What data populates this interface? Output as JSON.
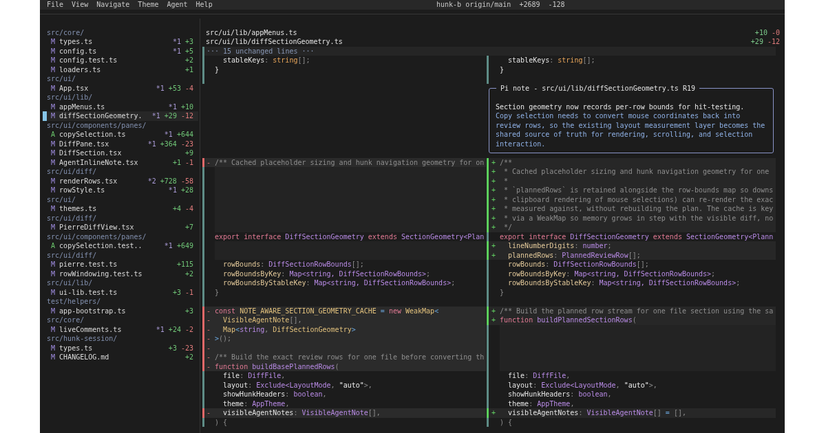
{
  "menu": {
    "items": [
      "File",
      "View",
      "Navigate",
      "Theme",
      "Agent",
      "Help"
    ],
    "status": "hunk-b origin/main  +2689  -128"
  },
  "sidebar": {
    "groups": [
      {
        "folder": "src/core/",
        "files": [
          {
            "status": "M",
            "kind": "modified",
            "name": "types.ts",
            "comments": "*1",
            "added": "+3",
            "selected": false
          },
          {
            "status": "M",
            "kind": "modified",
            "name": "config.ts",
            "comments": "*1",
            "added": "+5",
            "selected": false
          },
          {
            "status": "M",
            "kind": "modified",
            "name": "config.test.ts",
            "added": "+2",
            "selected": false
          },
          {
            "status": "M",
            "kind": "modified",
            "name": "loaders.ts",
            "added": "+1",
            "selected": false
          }
        ]
      },
      {
        "folder": "src/ui/",
        "files": [
          {
            "status": "M",
            "kind": "modified",
            "name": "App.tsx",
            "comments": "*1",
            "added": "+53",
            "removed": "-4",
            "selected": false
          }
        ]
      },
      {
        "folder": "src/ui/lib/",
        "files": [
          {
            "status": "M",
            "kind": "modified",
            "name": "appMenus.ts",
            "comments": "*1",
            "added": "+10",
            "selected": false
          },
          {
            "status": "M",
            "kind": "modified",
            "name": "diffSectionGeometry.",
            "comments": "*1",
            "added": "+29",
            "removed": "-12",
            "selected": true
          }
        ]
      },
      {
        "folder": "src/ui/components/panes/",
        "files": [
          {
            "status": "A",
            "kind": "added",
            "name": "copySelection.ts",
            "comments": "*1",
            "added": "+644",
            "selected": false
          },
          {
            "status": "M",
            "kind": "modified",
            "name": "DiffPane.tsx",
            "comments": "*1",
            "added": "+364",
            "removed": "-23",
            "selected": false
          },
          {
            "status": "M",
            "kind": "modified",
            "name": "DiffSection.tsx",
            "added": "+9",
            "selected": false
          },
          {
            "status": "M",
            "kind": "modified",
            "name": "AgentInlineNote.tsx",
            "added": "+1",
            "removed": "-1",
            "selected": false
          }
        ]
      },
      {
        "folder": "src/ui/diff/",
        "files": [
          {
            "status": "M",
            "kind": "modified",
            "name": "renderRows.tsx",
            "comments": "*2",
            "added": "+728",
            "removed": "-58",
            "selected": false
          },
          {
            "status": "M",
            "kind": "modified",
            "name": "rowStyle.ts",
            "comments": "*1",
            "added": "+28",
            "selected": false
          }
        ]
      },
      {
        "folder": "src/ui/",
        "files": [
          {
            "status": "M",
            "kind": "modified",
            "name": "themes.ts",
            "added": "+4",
            "removed": "-4",
            "selected": false
          }
        ]
      },
      {
        "folder": "src/ui/diff/",
        "files": [
          {
            "status": "M",
            "kind": "modified",
            "name": "PierreDiffView.tsx",
            "added": "+7",
            "selected": false
          }
        ]
      },
      {
        "folder": "src/ui/components/panes/",
        "files": [
          {
            "status": "A",
            "kind": "added",
            "name": "copySelection.test..",
            "comments": "*1",
            "added": "+649",
            "selected": false
          }
        ]
      },
      {
        "folder": "src/ui/diff/",
        "files": [
          {
            "status": "M",
            "kind": "modified",
            "name": "pierre.test.ts",
            "added": "+115",
            "selected": false
          },
          {
            "status": "M",
            "kind": "modified",
            "name": "rowWindowing.test.ts",
            "added": "+2",
            "selected": false
          }
        ]
      },
      {
        "folder": "src/ui/lib/",
        "files": [
          {
            "status": "M",
            "kind": "modified",
            "name": "ui-lib.test.ts",
            "added": "+3",
            "removed": "-1",
            "selected": false
          }
        ]
      },
      {
        "folder": "test/helpers/",
        "files": [
          {
            "status": "M",
            "kind": "modified",
            "name": "app-bootstrap.ts",
            "added": "+3",
            "selected": false
          }
        ]
      },
      {
        "folder": "src/core/",
        "files": [
          {
            "status": "M",
            "kind": "modified",
            "name": "liveComments.ts",
            "comments": "*1",
            "added": "+24",
            "removed": "-2",
            "selected": false
          }
        ]
      },
      {
        "folder": "src/hunk-session/",
        "files": [
          {
            "status": "M",
            "kind": "modified",
            "name": "types.ts",
            "added": "+3",
            "removed": "-23",
            "selected": false
          },
          {
            "status": "M",
            "kind": "modified",
            "name": "CHANGELOG.md",
            "added": "+2",
            "selected": false
          }
        ]
      }
    ]
  },
  "diff": {
    "files": [
      {
        "path": "src/ui/lib/appMenus.ts",
        "added": "+10",
        "removed": "-0"
      },
      {
        "path": "src/ui/lib/diffSectionGeometry.ts",
        "added": "+29",
        "removed": "-12"
      }
    ],
    "rows": [
      {
        "kind": "separator",
        "text": "··· 15 unchanged lines ···"
      },
      {
        "kind": "split",
        "left": {
          "kind": "context",
          "tokens": [
            {
              "kind": "name",
              "text": "  stableKeys"
            },
            {
              "kind": "punctuation",
              "text": ": "
            },
            {
              "kind": "builtin",
              "text": "string"
            },
            {
              "kind": "punctuation",
              "text": "[];"
            }
          ]
        },
        "right": {
          "kind": "context",
          "tokens": [
            {
              "kind": "name",
              "text": "  stableKeys"
            },
            {
              "kind": "punctuation",
              "text": ": "
            },
            {
              "kind": "builtin",
              "text": "string"
            },
            {
              "kind": "punctuation",
              "text": "[];"
            }
          ]
        }
      },
      {
        "kind": "split",
        "left": {
          "kind": "context",
          "tokens": [
            {
              "kind": "name",
              "text": "}"
            }
          ]
        },
        "right": {
          "kind": "context",
          "tokens": [
            {
              "kind": "name",
              "text": "}"
            }
          ]
        }
      },
      {
        "kind": "split",
        "left": {
          "kind": "context"
        },
        "right": {
          "kind": "context"
        }
      },
      {
        "kind": "note",
        "title": "Pi note - src/ui/lib/diffSectionGeometry.ts R19",
        "summary": "Section geometry now records per-row bounds for hit-testing.",
        "body": "Copy selection needs to convert mouse coordinates back into review rows, so the existing layout measurement layer becomes the shared source of truth for rendering, scrolling, and selection interaction."
      },
      {
        "kind": "split",
        "left": {
          "kind": "delete",
          "marker": "-",
          "tokens": [
            {
              "kind": "comment",
              "text": "/** Cached placeholder sizing and hunk navigation geometry for on"
            }
          ]
        },
        "right": {
          "kind": "add",
          "marker": "+",
          "tokens": [
            {
              "kind": "comment",
              "text": "/**"
            }
          ]
        }
      },
      {
        "kind": "split",
        "left": {
          "kind": "filler"
        },
        "right": {
          "kind": "add",
          "marker": "+",
          "tokens": [
            {
              "kind": "comment",
              "text": " * Cached placeholder sizing and hunk navigation geometry for one"
            }
          ]
        }
      },
      {
        "kind": "split",
        "left": {
          "kind": "filler"
        },
        "right": {
          "kind": "add",
          "marker": "+",
          "tokens": [
            {
              "kind": "comment",
              "text": " *"
            }
          ]
        }
      },
      {
        "kind": "split",
        "left": {
          "kind": "filler"
        },
        "right": {
          "kind": "add",
          "marker": "+",
          "tokens": [
            {
              "kind": "comment",
              "text": " * `plannedRows` is retained alongside the row-bounds map so downs"
            }
          ]
        }
      },
      {
        "kind": "split",
        "left": {
          "kind": "filler"
        },
        "right": {
          "kind": "add",
          "marker": "+",
          "tokens": [
            {
              "kind": "comment",
              "text": " * clipboard rendering of mouse selections) can re-render the exac"
            }
          ]
        }
      },
      {
        "kind": "split",
        "left": {
          "kind": "filler"
        },
        "right": {
          "kind": "add",
          "marker": "+",
          "tokens": [
            {
              "kind": "comment",
              "text": " * measured against, without rebuilding the plan. The cache is key"
            }
          ]
        }
      },
      {
        "kind": "split",
        "left": {
          "kind": "filler"
        },
        "right": {
          "kind": "add",
          "marker": "+",
          "tokens": [
            {
              "kind": "comment",
              "text": " * via a WeakMap so memory grows in step with the visible diff, no"
            }
          ]
        }
      },
      {
        "kind": "split",
        "left": {
          "kind": "filler"
        },
        "right": {
          "kind": "add",
          "marker": "+",
          "tokens": [
            {
              "kind": "comment",
              "text": " */"
            }
          ]
        }
      },
      {
        "kind": "split",
        "left": {
          "kind": "context",
          "tokens": [
            {
              "kind": "keyword",
              "text": "export interface "
            },
            {
              "kind": "type",
              "text": "DiffSectionGeometry "
            },
            {
              "kind": "keyword",
              "text": "extends "
            },
            {
              "kind": "type",
              "text": "SectionGeometry<Plan"
            }
          ]
        },
        "right": {
          "kind": "context",
          "tokens": [
            {
              "kind": "keyword",
              "text": "export interface "
            },
            {
              "kind": "type",
              "text": "DiffSectionGeometry "
            },
            {
              "kind": "keyword",
              "text": "extends "
            },
            {
              "kind": "type",
              "text": "SectionGeometry<Plann"
            }
          ]
        }
      },
      {
        "kind": "split",
        "left": {
          "kind": "filler"
        },
        "right": {
          "kind": "add",
          "marker": "+",
          "tokens": [
            {
              "kind": "property",
              "text": "  lineNumberDigits"
            },
            {
              "kind": "punctuation",
              "text": ": "
            },
            {
              "kind": "type",
              "text": "number"
            },
            {
              "kind": "punctuation",
              "text": ";"
            }
          ]
        }
      },
      {
        "kind": "split",
        "left": {
          "kind": "filler"
        },
        "right": {
          "kind": "add",
          "marker": "+",
          "tokens": [
            {
              "kind": "property",
              "text": "  plannedRows"
            },
            {
              "kind": "punctuation",
              "text": ": "
            },
            {
              "kind": "type",
              "text": "PlannedReviewRow"
            },
            {
              "kind": "punctuation",
              "text": "[];"
            }
          ]
        }
      },
      {
        "kind": "split",
        "left": {
          "kind": "context",
          "tokens": [
            {
              "kind": "property",
              "text": "  rowBounds"
            },
            {
              "kind": "punctuation",
              "text": ": "
            },
            {
              "kind": "type",
              "text": "DiffSectionRowBounds"
            },
            {
              "kind": "punctuation",
              "text": "[];"
            }
          ]
        },
        "right": {
          "kind": "context",
          "tokens": [
            {
              "kind": "property",
              "text": "  rowBounds"
            },
            {
              "kind": "punctuation",
              "text": ": "
            },
            {
              "kind": "type",
              "text": "DiffSectionRowBounds"
            },
            {
              "kind": "punctuation",
              "text": "[];"
            }
          ]
        }
      },
      {
        "kind": "split",
        "left": {
          "kind": "context",
          "tokens": [
            {
              "kind": "property",
              "text": "  rowBoundsByKey"
            },
            {
              "kind": "punctuation",
              "text": ": "
            },
            {
              "kind": "type",
              "text": "Map<string, DiffSectionRowBounds>"
            },
            {
              "kind": "punctuation",
              "text": ";"
            }
          ]
        },
        "right": {
          "kind": "context",
          "tokens": [
            {
              "kind": "property",
              "text": "  rowBoundsByKey"
            },
            {
              "kind": "punctuation",
              "text": ": "
            },
            {
              "kind": "type",
              "text": "Map<string, DiffSectionRowBounds>"
            },
            {
              "kind": "punctuation",
              "text": ";"
            }
          ]
        }
      },
      {
        "kind": "split",
        "left": {
          "kind": "context",
          "tokens": [
            {
              "kind": "property",
              "text": "  rowBoundsByStableKey"
            },
            {
              "kind": "punctuation",
              "text": ": "
            },
            {
              "kind": "type",
              "text": "Map<string, DiffSectionRowBounds>"
            },
            {
              "kind": "punctuation",
              "text": ";"
            }
          ]
        },
        "right": {
          "kind": "context",
          "tokens": [
            {
              "kind": "property",
              "text": "  rowBoundsByStableKey"
            },
            {
              "kind": "punctuation",
              "text": ": "
            },
            {
              "kind": "type",
              "text": "Map<string, DiffSectionRowBounds>"
            },
            {
              "kind": "punctuation",
              "text": ";"
            }
          ]
        }
      },
      {
        "kind": "split",
        "left": {
          "kind": "context",
          "tokens": [
            {
              "kind": "punctuation",
              "text": "}"
            }
          ]
        },
        "right": {
          "kind": "context",
          "tokens": [
            {
              "kind": "punctuation",
              "text": "}"
            }
          ]
        }
      },
      {
        "kind": "split",
        "left": {
          "kind": "context"
        },
        "right": {
          "kind": "context"
        }
      },
      {
        "kind": "split",
        "left": {
          "kind": "delete",
          "marker": "-",
          "tokens": [
            {
              "kind": "keyword",
              "text": "const "
            },
            {
              "kind": "constant",
              "text": "NOTE_AWARE_SECTION_GEOMETRY_CACHE "
            },
            {
              "kind": "operator",
              "text": "= "
            },
            {
              "kind": "keyword",
              "text": "new "
            },
            {
              "kind": "constant",
              "text": "WeakMap"
            },
            {
              "kind": "operator",
              "text": "<"
            }
          ]
        },
        "right": {
          "kind": "add",
          "marker": "+",
          "tokens": [
            {
              "kind": "comment",
              "text": "/** Build the planned row stream for one file section using the sa"
            }
          ]
        }
      },
      {
        "kind": "split",
        "left": {
          "kind": "delete",
          "marker": "-",
          "tokens": [
            {
              "kind": "constant",
              "text": "  VisibleAgentNote"
            },
            {
              "kind": "punctuation",
              "text": "[],"
            }
          ]
        },
        "right": {
          "kind": "add",
          "marker": "+",
          "tokens": [
            {
              "kind": "keyword",
              "text": "function "
            },
            {
              "kind": "type",
              "text": "buildPlannedSectionRows"
            },
            {
              "kind": "punctuation",
              "text": "("
            }
          ]
        }
      },
      {
        "kind": "split",
        "left": {
          "kind": "delete",
          "marker": "-",
          "tokens": [
            {
              "kind": "constant",
              "text": "  Map"
            },
            {
              "kind": "operator",
              "text": "<"
            },
            {
              "kind": "type",
              "text": "string"
            },
            {
              "kind": "punctuation",
              "text": ", "
            },
            {
              "kind": "constant",
              "text": "DiffSectionGeometry"
            },
            {
              "kind": "operator",
              "text": ">"
            }
          ]
        },
        "right": {
          "kind": "filler"
        }
      },
      {
        "kind": "split",
        "left": {
          "kind": "delete",
          "marker": "-",
          "tokens": [
            {
              "kind": "operator",
              "text": ">"
            },
            {
              "kind": "punctuation",
              "text": "();"
            }
          ]
        },
        "right": {
          "kind": "filler"
        }
      },
      {
        "kind": "split",
        "left": {
          "kind": "delete",
          "marker": "-"
        },
        "right": {
          "kind": "filler"
        }
      },
      {
        "kind": "split",
        "left": {
          "kind": "delete",
          "marker": "-",
          "tokens": [
            {
              "kind": "comment",
              "text": "/** Build the exact review rows for one file before converting th"
            }
          ]
        },
        "right": {
          "kind": "filler"
        }
      },
      {
        "kind": "split",
        "left": {
          "kind": "delete",
          "marker": "-",
          "tokens": [
            {
              "kind": "keyword",
              "text": "function "
            },
            {
              "kind": "type",
              "text": "buildBasePlannedRows"
            },
            {
              "kind": "punctuation",
              "text": "("
            }
          ]
        },
        "right": {
          "kind": "filler"
        }
      },
      {
        "kind": "split",
        "left": {
          "kind": "context",
          "tokens": [
            {
              "kind": "name",
              "text": "  file"
            },
            {
              "kind": "punctuation",
              "text": ": "
            },
            {
              "kind": "type",
              "text": "DiffFile"
            },
            {
              "kind": "punctuation",
              "text": ","
            }
          ]
        },
        "right": {
          "kind": "context",
          "tokens": [
            {
              "kind": "name",
              "text": "  file"
            },
            {
              "kind": "punctuation",
              "text": ": "
            },
            {
              "kind": "type",
              "text": "DiffFile"
            },
            {
              "kind": "punctuation",
              "text": ","
            }
          ]
        }
      },
      {
        "kind": "split",
        "left": {
          "kind": "context",
          "tokens": [
            {
              "kind": "name",
              "text": "  layout"
            },
            {
              "kind": "punctuation",
              "text": ": "
            },
            {
              "kind": "type",
              "text": "Exclude<LayoutMode"
            },
            {
              "kind": "punctuation",
              "text": ", "
            },
            {
              "kind": "string",
              "text": "\"auto\""
            },
            {
              "kind": "punctuation",
              "text": ">,"
            }
          ]
        },
        "right": {
          "kind": "context",
          "tokens": [
            {
              "kind": "name",
              "text": "  layout"
            },
            {
              "kind": "punctuation",
              "text": ": "
            },
            {
              "kind": "type",
              "text": "Exclude<LayoutMode"
            },
            {
              "kind": "punctuation",
              "text": ", "
            },
            {
              "kind": "string",
              "text": "\"auto\""
            },
            {
              "kind": "punctuation",
              "text": ">,"
            }
          ]
        }
      },
      {
        "kind": "split",
        "left": {
          "kind": "context",
          "tokens": [
            {
              "kind": "name",
              "text": "  showHunkHeaders"
            },
            {
              "kind": "punctuation",
              "text": ": "
            },
            {
              "kind": "type",
              "text": "boolean"
            },
            {
              "kind": "punctuation",
              "text": ","
            }
          ]
        },
        "right": {
          "kind": "context",
          "tokens": [
            {
              "kind": "name",
              "text": "  showHunkHeaders"
            },
            {
              "kind": "punctuation",
              "text": ": "
            },
            {
              "kind": "type",
              "text": "boolean"
            },
            {
              "kind": "punctuation",
              "text": ","
            }
          ]
        }
      },
      {
        "kind": "split",
        "left": {
          "kind": "context",
          "tokens": [
            {
              "kind": "name",
              "text": "  theme"
            },
            {
              "kind": "punctuation",
              "text": ": "
            },
            {
              "kind": "type",
              "text": "AppTheme"
            },
            {
              "kind": "punctuation",
              "text": ","
            }
          ]
        },
        "right": {
          "kind": "context",
          "tokens": [
            {
              "kind": "name",
              "text": "  theme"
            },
            {
              "kind": "punctuation",
              "text": ": "
            },
            {
              "kind": "type",
              "text": "AppTheme"
            },
            {
              "kind": "punctuation",
              "text": ","
            }
          ]
        }
      },
      {
        "kind": "split",
        "left": {
          "kind": "delete",
          "marker": "-",
          "tokens": [
            {
              "kind": "name",
              "text": "  visibleAgentNotes"
            },
            {
              "kind": "punctuation",
              "text": ": "
            },
            {
              "kind": "type",
              "text": "VisibleAgentNote"
            },
            {
              "kind": "punctuation",
              "text": "[],"
            }
          ]
        },
        "right": {
          "kind": "add",
          "marker": "+",
          "tokens": [
            {
              "kind": "name",
              "text": "  visibleAgentNotes"
            },
            {
              "kind": "punctuation",
              "text": ": "
            },
            {
              "kind": "type",
              "text": "VisibleAgentNote"
            },
            {
              "kind": "punctuation",
              "text": "[] "
            },
            {
              "kind": "operator",
              "text": "= "
            },
            {
              "kind": "punctuation",
              "text": "[],"
            }
          ]
        }
      },
      {
        "kind": "split",
        "left": {
          "kind": "context",
          "tokens": [
            {
              "kind": "punctuation",
              "text": ") {"
            }
          ]
        },
        "right": {
          "kind": "context",
          "tokens": [
            {
              "kind": "punctuation",
              "text": ") {"
            }
          ]
        }
      }
    ]
  }
}
